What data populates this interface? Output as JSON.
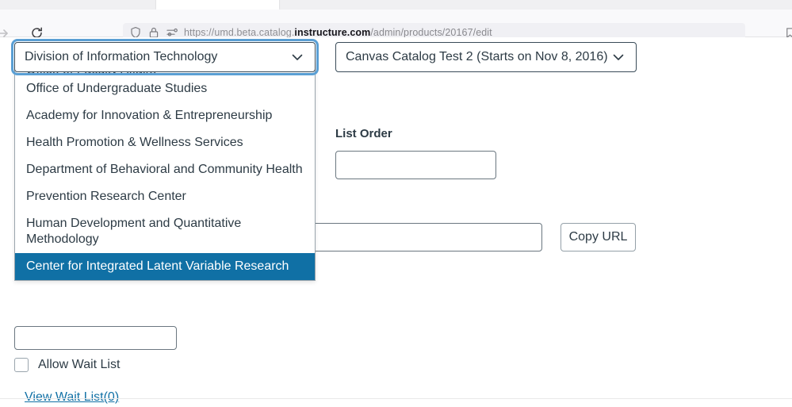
{
  "browser": {
    "url_scheme": "https://umd.beta.catalog.",
    "url_host_strong": "instructure.com",
    "url_path": "/admin/products/20167/edit",
    "forward_icon": "arrow-forward-icon",
    "reload_icon": "reload-icon",
    "shield_icon": "shield-icon",
    "lock_icon": "lock-icon",
    "permissions_icon": "permissions-sliders-icon",
    "bookmark_icon": "bookmark-icon"
  },
  "form": {
    "department_select": {
      "value": "Division of Information Technology",
      "chevron_icon": "chevron-down-icon",
      "options": [
        "Office of Faculty Affairs",
        "Office of Undergraduate Studies",
        "Academy for Innovation & Entrepreneurship",
        "Health Promotion & Wellness Services",
        "Department of Behavioral and Community Health",
        "Prevention Research Center",
        "Human Development and Quantitative Methodology",
        "Center for Integrated Latent Variable Research"
      ],
      "selected_option": "Center for Integrated Latent Variable Research"
    },
    "term_select": {
      "value": "Canvas Catalog Test 2 (Starts on Nov 8, 2016)",
      "chevron_icon": "chevron-down-icon"
    },
    "list_order": {
      "label": "List Order",
      "value": "",
      "placeholder": ""
    },
    "product_url": {
      "value": "",
      "placeholder": ""
    },
    "copy_url_button": "Copy URL",
    "hidden_field": {
      "value": "",
      "placeholder": ""
    },
    "allow_wait_list": {
      "label": "Allow Wait List",
      "checked": false
    },
    "view_wait_list_link": "View Wait List(0)"
  },
  "colors": {
    "accent_blue": "#1070a5",
    "focus_ring": "#5a9fd4",
    "text": "#2d3b45"
  }
}
